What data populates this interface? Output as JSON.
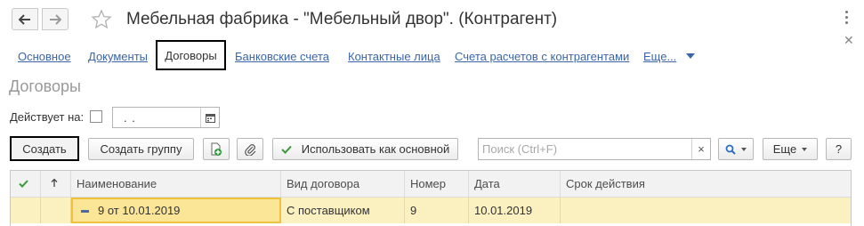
{
  "header": {
    "title": "Мебельная фабрика - \"Мебельный двор\". (Контрагент)",
    "back_icon": "arrow-left-icon",
    "forward_icon": "arrow-right-icon",
    "favorite_icon": "star-icon"
  },
  "tabs": [
    {
      "label": "Основное"
    },
    {
      "label": "Документы"
    },
    {
      "label": "Договоры",
      "active": true
    },
    {
      "label": "Банковские счета"
    },
    {
      "label": "Контактные лица"
    },
    {
      "label": "Счета расчетов с контрагентами"
    },
    {
      "label": "Еще..."
    }
  ],
  "section": {
    "title": "Договоры"
  },
  "filter": {
    "label": "Действует на:",
    "checked": false,
    "date_value": " .  ."
  },
  "toolbar": {
    "create": "Создать",
    "create_group": "Создать группу",
    "use_as_main": "Использовать как основной",
    "search_placeholder": "Поиск (Ctrl+F)",
    "search_clear": "×",
    "more": "Еще",
    "help": "?"
  },
  "table": {
    "columns": [
      "Наименование",
      "Вид договора",
      "Номер",
      "Дата",
      "Срок действия"
    ],
    "rows": [
      {
        "name": "9 от 10.01.2019",
        "kind": "С поставщиком",
        "number": "9",
        "date": "10.01.2019",
        "term": ""
      }
    ]
  },
  "colors": {
    "link": "#3b66a8",
    "row_selected": "#fbf0c0",
    "cell_current_border": "#f0c23c",
    "check_green": "#3a9a3a"
  }
}
